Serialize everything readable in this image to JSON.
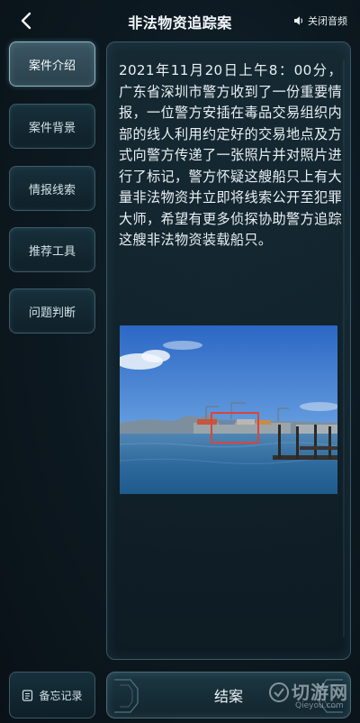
{
  "header": {
    "title": "非法物资追踪案",
    "back_icon": "chevron-left-icon",
    "audio_label": "关闭音频",
    "audio_icon": "speaker-icon"
  },
  "sidebar": {
    "items": [
      {
        "label": "案件介绍",
        "active": true
      },
      {
        "label": "案件背景",
        "active": false
      },
      {
        "label": "情报线索",
        "active": false
      },
      {
        "label": "推荐工具",
        "active": false
      },
      {
        "label": "问题判断",
        "active": false
      }
    ]
  },
  "main": {
    "intro_text": "2021年11月20日上午8：00分，广东省深圳市警方收到了一份重要情报，一位警方安插在毒品交易组织内部的线人利用约定好的交易地点及方式向警方传递了一张照片并对照片进行了标记，警方怀疑这艘船只上有大量非法物资并立即将线索公开至犯罪大师，希望有更多侦探协助警方追踪这艘非法物资装载船只。",
    "photo_description_icon": "harbor-photo",
    "marker_color": "#d9463a"
  },
  "footer": {
    "memo_label": "备忘记录",
    "memo_icon": "notebook-icon",
    "close_case_label": "结案"
  },
  "watermark": {
    "main": "切游网",
    "sub": "Qieyou.com"
  },
  "colors": {
    "background": "#0c161d",
    "panel_border": "#3a5866",
    "active_border": "#8fb7c4"
  }
}
